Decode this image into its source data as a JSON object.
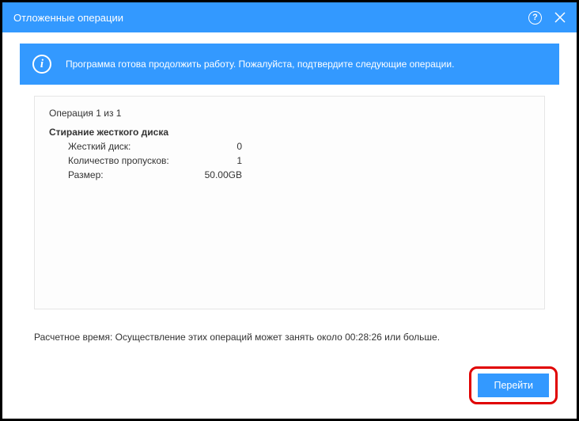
{
  "titlebar": {
    "title": "Отложенные операции",
    "help_label": "?"
  },
  "banner": {
    "icon_letter": "i",
    "message": "Программа готова продолжить работу. Пожалуйста, подтвердите следующие операции."
  },
  "operations": {
    "counter": "Операция 1 из 1",
    "title": "Стирание жесткого диска",
    "rows": [
      {
        "label": "Жесткий диск:",
        "value": "0"
      },
      {
        "label": "Количество пропусков:",
        "value": "1"
      },
      {
        "label": "Размер:",
        "value": "50.00GB"
      }
    ]
  },
  "estimate": "Расчетное время: Осуществление этих операций может занять около 00:28:26 или больше.",
  "buttons": {
    "go": "Перейти"
  }
}
